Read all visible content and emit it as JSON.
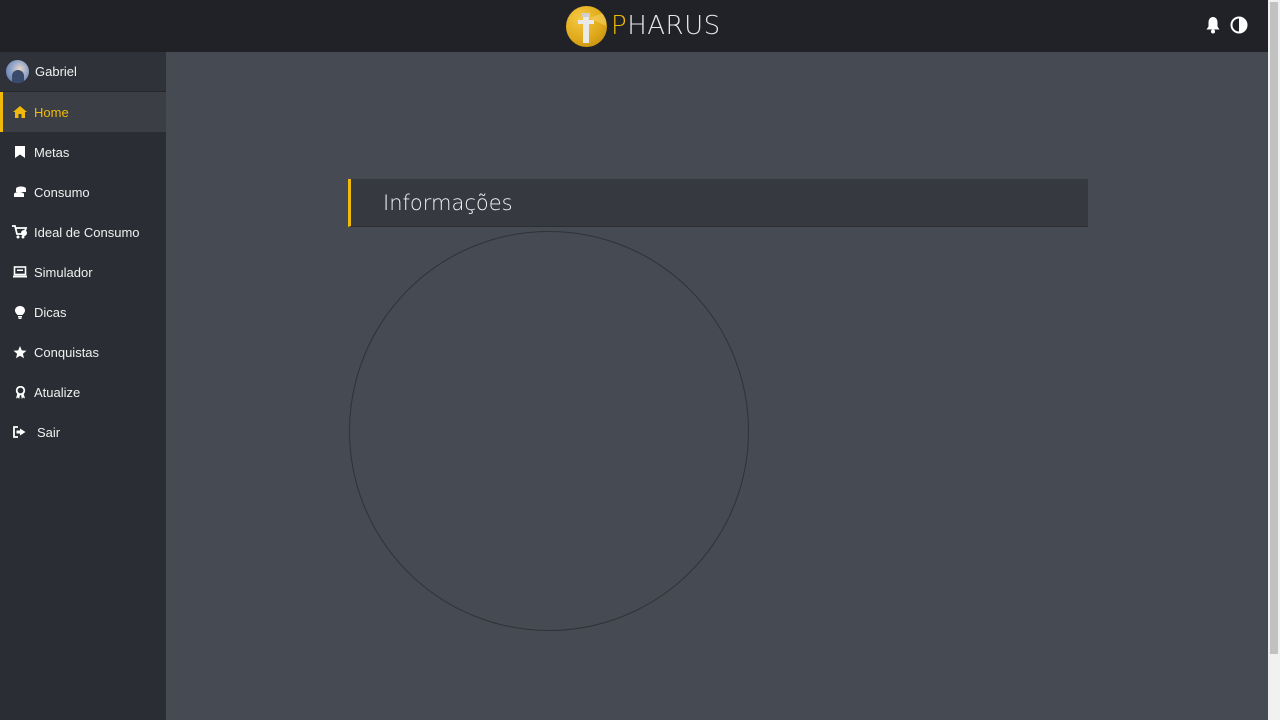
{
  "header": {
    "logo_first_letter": "P",
    "logo_rest": "HARUS",
    "icons": [
      "bell-icon",
      "contrast-icon"
    ]
  },
  "user": {
    "name": "Gabriel"
  },
  "sidebar": {
    "items": [
      {
        "label": "Home",
        "icon": "home-icon",
        "active": true
      },
      {
        "label": "Metas",
        "icon": "bookmark-icon"
      },
      {
        "label": "Consumo",
        "icon": "coins-icon"
      },
      {
        "label": "Ideal de Consumo",
        "icon": "cart-icon"
      },
      {
        "label": "Simulador",
        "icon": "laptop-icon"
      },
      {
        "label": "Dicas",
        "icon": "lightbulb-icon"
      },
      {
        "label": "Conquistas",
        "icon": "star-icon"
      },
      {
        "label": "Atualize",
        "icon": "award-icon"
      },
      {
        "label": "Sair",
        "icon": "sign-out-icon"
      }
    ]
  },
  "main": {
    "section_title": "Informações"
  },
  "colors": {
    "accent": "#f0b90b",
    "topbar": "#202227",
    "sidebar": "#2a2d33",
    "main_bg": "#464a52"
  }
}
